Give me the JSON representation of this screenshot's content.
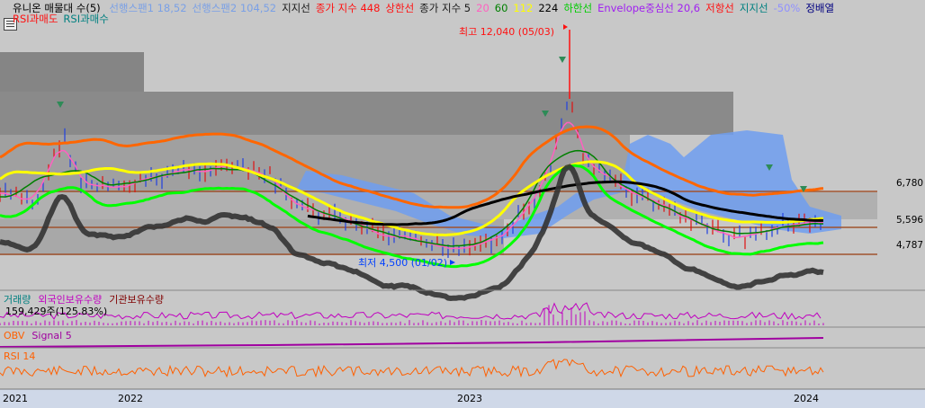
{
  "title": "유니온 매물대 수(5)",
  "legend_top": [
    {
      "label": "선행스팬1 18,52",
      "color": "#7aa0e6"
    },
    {
      "label": "선행스팬2 104,52",
      "color": "#7aa0e6"
    },
    {
      "label": "지지선",
      "color": "#1a1a1a"
    },
    {
      "label": "종가 지수 448",
      "color": "#ff1010"
    },
    {
      "label": "상한선",
      "color": "#ff1010"
    },
    {
      "label": "종가 지수 5",
      "color": "#1a1a1a"
    },
    {
      "label": "20",
      "color": "#ff60c0"
    },
    {
      "label": "60",
      "color": "#008000"
    },
    {
      "label": "112",
      "color": "#ffff00"
    },
    {
      "label": "224",
      "color": "#000000"
    },
    {
      "label": "하한선",
      "color": "#00cc00"
    },
    {
      "label": "Envelope중심선 20,6",
      "color": "#a020f0"
    },
    {
      "label": "저항선",
      "color": "#ff1010"
    },
    {
      "label": "지지선",
      "color": "#008080"
    },
    {
      "label": "-50%",
      "color": "#9090ff"
    },
    {
      "label": "정배열",
      "color": "#000080"
    }
  ],
  "legend_second": [
    {
      "label": "RSI과매도",
      "color": "#ff1010"
    },
    {
      "label": "RSI과매수",
      "color": "#008080"
    }
  ],
  "annotations": {
    "high": "최고 12,040 (05/03)",
    "low": "최저 4,500 (01/02)"
  },
  "price_levels": [
    "6,780",
    "5,596",
    "4,787"
  ],
  "volume_panel": {
    "legend": [
      {
        "label": "거래량",
        "color": "#008080"
      },
      {
        "label": "외국인보유수량",
        "color": "#c000c0"
      },
      {
        "label": "기관보유수량",
        "color": "#800000"
      }
    ],
    "value": "159,429주(125.83%)"
  },
  "obv_panel": {
    "legend": [
      {
        "label": "OBV",
        "color": "#ff6000"
      },
      {
        "label": "Signal 5",
        "color": "#a000a0"
      }
    ]
  },
  "rsi_panel": {
    "legend": [
      {
        "label": "RSI 14",
        "color": "#ff6000"
      }
    ]
  },
  "x_axis": [
    "2021",
    "2022",
    "2023",
    "2024"
  ],
  "chart_data": {
    "type": "line",
    "title": "유니온 매물대 수(5)",
    "x": [
      "2021",
      "2022",
      "2023",
      "2024"
    ],
    "high_marker": {
      "value": 12040,
      "date": "05/03"
    },
    "low_marker": {
      "value": 4500,
      "date": "01/02"
    },
    "horizontal_levels": [
      6780,
      5596,
      4787
    ],
    "volume_profile_bands": 5,
    "series": [
      {
        "name": "종가 지수 5",
        "color": "#333333"
      },
      {
        "name": "224",
        "color": "#000000"
      },
      {
        "name": "112",
        "color": "#ffff00"
      },
      {
        "name": "60",
        "color": "#008000"
      },
      {
        "name": "20",
        "color": "#ff60c0"
      },
      {
        "name": "하한선",
        "color": "#00ff00"
      },
      {
        "name": "상한선",
        "color": "#ff6600"
      }
    ],
    "grid": false,
    "legend": "top-left"
  },
  "colors": {
    "bg_main": "#c8c8c8",
    "band_dark": "#7a7a7a",
    "band_light": "#9a9a9a",
    "cloud": "#6f9df0",
    "level_line": "#a0522d",
    "axis_bg": "#cfd8e8"
  }
}
